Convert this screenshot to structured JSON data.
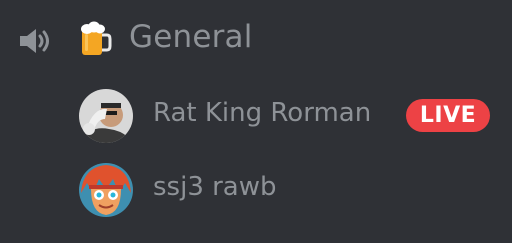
{
  "channel": {
    "name": "General",
    "type_icon": "speaker-icon",
    "emoji_icon": "beer-mug-icon"
  },
  "members": [
    {
      "name": "Rat King Rorman",
      "badge": "LIVE",
      "avatar": "avatar-rat-king-rorman"
    },
    {
      "name": "ssj3 rawb",
      "avatar": "avatar-ssj3-rawb"
    }
  ],
  "colors": {
    "background": "#2f3136",
    "muted_text": "#8e9297",
    "live_badge": "#ed4245"
  }
}
